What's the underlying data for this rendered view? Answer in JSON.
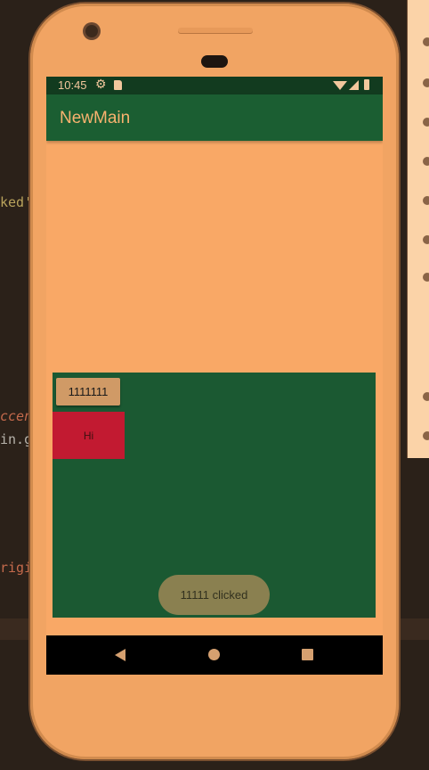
{
  "ide_background": {
    "fragments": [
      "ked'",
      "ccen",
      "in.g",
      "rigi"
    ]
  },
  "status_bar": {
    "time": "10:45",
    "icons": [
      "gear-icon",
      "sd-card-icon",
      "wifi-icon",
      "signal-icon",
      "battery-icon"
    ]
  },
  "app_bar": {
    "title": "NewMain"
  },
  "content": {
    "button_label": "1111111",
    "hi_text": "Hi",
    "toast_text": "11111 clicked"
  },
  "nav_bar": {
    "icons": [
      "back-icon",
      "home-icon",
      "recents-icon"
    ]
  },
  "colors": {
    "app_bar": "#1b5e32",
    "status_bar": "#123b1f",
    "screen_background": "#f9a866",
    "panel": "#1b5932",
    "hi_box": "#c21a31"
  }
}
